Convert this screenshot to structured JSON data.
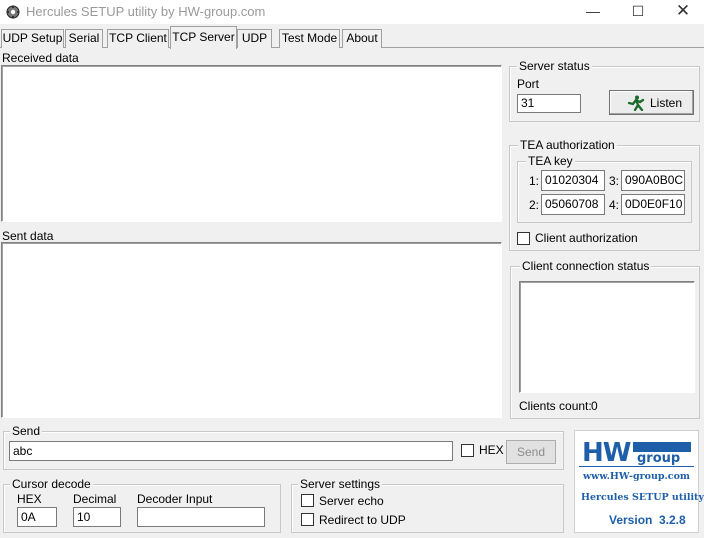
{
  "window": {
    "title": "Hercules SETUP utility by HW-group.com",
    "minimize_glyph": "—",
    "maximize_glyph": "☐",
    "close_glyph": "✕"
  },
  "tabs": [
    {
      "label": "UDP Setup"
    },
    {
      "label": "Serial"
    },
    {
      "label": "TCP Client"
    },
    {
      "label": "TCP Server",
      "active": true
    },
    {
      "label": "UDP"
    },
    {
      "label": "Test Mode"
    },
    {
      "label": "About"
    }
  ],
  "received": {
    "label": "Received data",
    "content": ""
  },
  "sent": {
    "label": "Sent data",
    "content": ""
  },
  "server_status": {
    "title": "Server status",
    "port_label": "Port",
    "port_value": "31",
    "listen_label": "Listen",
    "listen_icon": "running-man-icon"
  },
  "tea": {
    "title": "TEA authorization",
    "key_title": "TEA key",
    "keys": [
      {
        "index": "1:",
        "value": "01020304"
      },
      {
        "index": "2:",
        "value": "05060708"
      },
      {
        "index": "3:",
        "value": "090A0B0C"
      },
      {
        "index": "4:",
        "value": "0D0E0F10"
      }
    ],
    "client_auth_label": "Client authorization",
    "client_auth_checked": false
  },
  "client_status": {
    "title": "Client connection status",
    "count_label": "Clients count:",
    "count_value": "0"
  },
  "send": {
    "title": "Send",
    "value": "abc",
    "hex_label": "HEX",
    "hex_checked": false,
    "button_label": "Send"
  },
  "cursor_decode": {
    "title": "Cursor decode",
    "hex_label": "HEX",
    "hex_value": "0A",
    "decimal_label": "Decimal",
    "decimal_value": "10",
    "decoder_label": "Decoder Input",
    "decoder_value": ""
  },
  "server_settings": {
    "title": "Server settings",
    "echo_label": "Server echo",
    "echo_checked": false,
    "redirect_label": "Redirect to UDP",
    "redirect_checked": false
  },
  "logo": {
    "brand_hw": "HW",
    "brand_group": "group",
    "url": "www.HW-group.com",
    "product": "Hercules SETUP utility",
    "version_label": "Version",
    "version_value": "3.2.8",
    "accent_color": "#1d5fa8"
  }
}
